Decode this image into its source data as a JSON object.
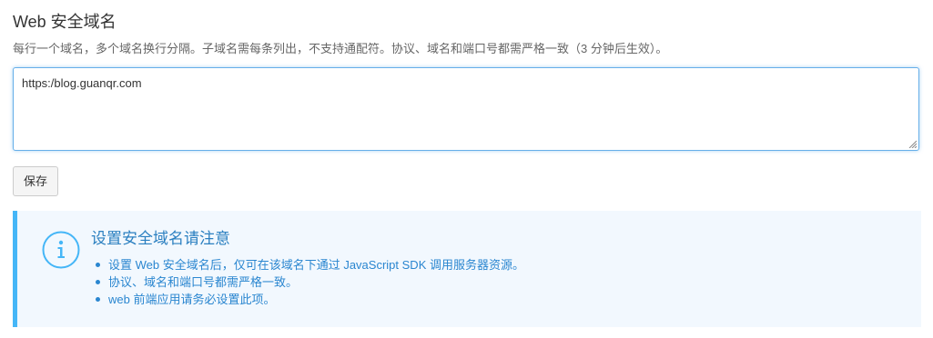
{
  "section": {
    "title": "Web 安全域名",
    "description": "每行一个域名，多个域名换行分隔。子域名需每条列出，不支持通配符。协议、域名和端口号都需严格一致（3 分钟后生效）。"
  },
  "domains_input": {
    "value": "https:/blog.guanqr.com"
  },
  "save_button": {
    "label": "保存"
  },
  "notice": {
    "icon": "info-circle-icon",
    "title": "设置安全域名请注意",
    "items": [
      "设置 Web 安全域名后，仅可在该域名下通过 JavaScript SDK 调用服务器资源。",
      "协议、域名和端口号都需严格一致。",
      "web 前端应用请务必设置此项。"
    ],
    "accent_color": "#45b6f7",
    "text_color": "#2a86d0",
    "background_color": "#f2f8fe"
  }
}
